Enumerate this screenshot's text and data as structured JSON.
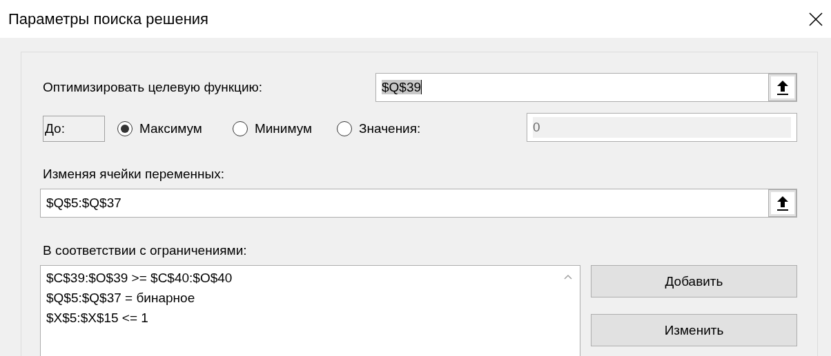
{
  "window": {
    "title": "Параметры поиска решения"
  },
  "objective": {
    "label": "Оптимизировать целевую функцию:",
    "value": "$Q$39",
    "value_selected": true
  },
  "to": {
    "label": "До:",
    "options": [
      {
        "label": "Максимум",
        "selected": true
      },
      {
        "label": "Минимум",
        "selected": false
      },
      {
        "label": "Значения:",
        "selected": false
      }
    ],
    "value_field": {
      "value": "0",
      "disabled": true
    }
  },
  "variables": {
    "label": "Изменяя ячейки переменных:",
    "value": "$Q$5:$Q$37"
  },
  "constraints": {
    "label": "В соответствии с ограничениями:",
    "items": [
      "$C$39:$O$39 >= $C$40:$O$40",
      "$Q$5:$Q$37 = бинарное",
      "$X$5:$X$15 <= 1"
    ],
    "buttons": [
      "Добавить",
      "Изменить"
    ]
  }
}
